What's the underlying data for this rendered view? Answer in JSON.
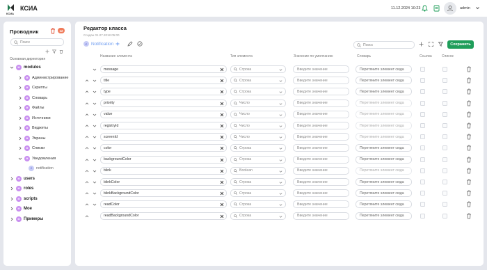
{
  "app": {
    "logo_text": "КСИА",
    "brand": "КСИА"
  },
  "topbar": {
    "datetime": "11.12.2024 10:23",
    "username": "admin"
  },
  "sidebar": {
    "title": "Проводник",
    "badge": "12",
    "search_placeholder": "Поиск",
    "dir_label": "Основная директория",
    "tree": [
      {
        "label": "modules",
        "level": 0,
        "expanded": true,
        "bold": true,
        "icon": "M"
      },
      {
        "label": "Администрирование",
        "level": 1,
        "icon": "M"
      },
      {
        "label": "Скрипты",
        "level": 1,
        "icon": "M"
      },
      {
        "label": "Словарь",
        "level": 1,
        "icon": "M"
      },
      {
        "label": "Файлы",
        "level": 1,
        "icon": "M"
      },
      {
        "label": "Источники",
        "level": 1,
        "icon": "M"
      },
      {
        "label": "Виджеты",
        "level": 1,
        "icon": "M"
      },
      {
        "label": "Экраны",
        "level": 1,
        "icon": "M"
      },
      {
        "label": "Списки",
        "level": 1,
        "icon": "M"
      },
      {
        "label": "Уведомления",
        "level": 1,
        "expanded": true,
        "icon": "M"
      },
      {
        "label": "notification",
        "level": 2,
        "icon": "C"
      },
      {
        "label": "users",
        "level": 0,
        "bold": true,
        "icon": "M"
      },
      {
        "label": "roles",
        "level": 0,
        "bold": true,
        "icon": "M"
      },
      {
        "label": "scripts",
        "level": 0,
        "bold": true,
        "icon": "M"
      },
      {
        "label": "Мое",
        "level": 0,
        "bold": true,
        "icon": "M"
      },
      {
        "label": "Примеры",
        "level": 0,
        "bold": true,
        "icon": "M"
      }
    ]
  },
  "editor": {
    "title": "Редактор класса",
    "created": "Создан 01.07.2018 05:00",
    "class_name": "Notification",
    "class_icon": "C",
    "search_placeholder": "Поиск",
    "save_label": "Сохранить",
    "headers": {
      "name": "Название элемента",
      "type": "Тип элемента",
      "default": "Значение по умолчанию",
      "dict": "Словарь",
      "link": "Ссылка",
      "list": "Список"
    },
    "default_placeholder": "Введите значение",
    "dict_placeholder": "Перетяните элемент сюда",
    "rows": [
      {
        "name": "message",
        "type": "Строка",
        "dict_disabled": false,
        "up": false,
        "down": true
      },
      {
        "name": "title",
        "type": "Строка",
        "dict_disabled": false,
        "up": true,
        "down": true
      },
      {
        "name": "type",
        "type": "Строка",
        "dict_disabled": false,
        "up": true,
        "down": true
      },
      {
        "name": "priority",
        "type": "Число",
        "dict_disabled": true,
        "up": true,
        "down": true
      },
      {
        "name": "value",
        "type": "Число",
        "dict_disabled": true,
        "up": true,
        "down": true
      },
      {
        "name": "registryId",
        "type": "Число",
        "dict_disabled": true,
        "up": true,
        "down": true
      },
      {
        "name": "screenId",
        "type": "Число",
        "dict_disabled": true,
        "up": true,
        "down": true
      },
      {
        "name": "color",
        "type": "Строка",
        "dict_disabled": false,
        "up": true,
        "down": true
      },
      {
        "name": "backgroundColor",
        "type": "Строка",
        "dict_disabled": false,
        "up": true,
        "down": true
      },
      {
        "name": "blink",
        "type": "Boolean",
        "dict_disabled": true,
        "up": true,
        "down": true
      },
      {
        "name": "blinkColor",
        "type": "Строка",
        "dict_disabled": false,
        "up": true,
        "down": true
      },
      {
        "name": "blinkBackgroundColor",
        "type": "Строка",
        "dict_disabled": false,
        "up": true,
        "down": true
      },
      {
        "name": "readColor",
        "type": "Строка",
        "dict_disabled": false,
        "up": true,
        "down": true
      },
      {
        "name": "readBackgroundColor",
        "type": "Строка",
        "dict_disabled": false,
        "up": true,
        "down": false
      }
    ]
  }
}
